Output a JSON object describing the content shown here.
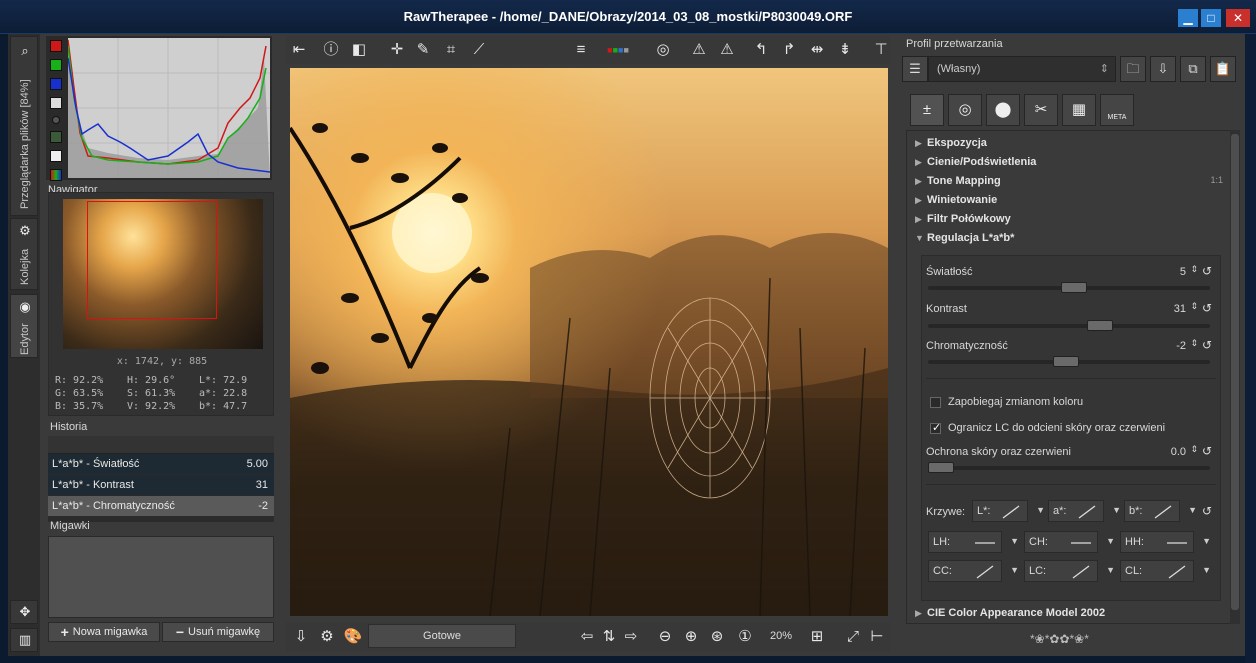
{
  "window": {
    "title": "RawTherapee  - /home/_DANE/Obrazy/2014_03_08_mostki/P8030049.ORF"
  },
  "left_tabs": {
    "file_browser": "Przeglądarka plików [84%]",
    "queue": "Kolejka",
    "editor": "Edytor"
  },
  "navigator": {
    "title": "Nawigator",
    "coords": "x: 1742, y: 885",
    "rgb": {
      "r": "R: 92.2%",
      "g": "G: 63.5%",
      "b": "B: 35.7%"
    },
    "hsv": {
      "h": "H: 29.6°",
      "s": "S: 61.3%",
      "v": "V: 92.2%"
    },
    "lab": {
      "l": "L*:  72.9",
      "a": "a*:  22.8",
      "b": "b*:  47.7"
    }
  },
  "history": {
    "title": "Historia",
    "rows": [
      {
        "name": "L*a*b* - Światłość",
        "value": "5.00"
      },
      {
        "name": "L*a*b* - Kontrast",
        "value": "31"
      },
      {
        "name": "L*a*b* - Chromatyczność",
        "value": "-2"
      }
    ]
  },
  "snapshots": {
    "title": "Migawki",
    "add_label": "Nowa migawka",
    "remove_label": "Usuń migawkę"
  },
  "statusbar": {
    "status": "Gotowe",
    "zoom": "20%"
  },
  "profile": {
    "label": "Profil przetwarzania",
    "value": "(Własny)"
  },
  "tools": {
    "exposure": "Ekspozycja",
    "shadows": "Cienie/Podświetlenia",
    "tonemap": "Tone Mapping",
    "tonemap_badge": "1:1",
    "vignette": "Winietowanie",
    "graduated": "Filtr Połówkowy",
    "lab": "Regulacja L*a*b*",
    "ciecam": "CIE Color Appearance Model 2002"
  },
  "lab": {
    "lightness": {
      "label": "Światłość",
      "value": "5",
      "fraction": 0.52
    },
    "contrast": {
      "label": "Kontrast",
      "value": "31",
      "fraction": 0.62
    },
    "chroma": {
      "label": "Chromatyczność",
      "value": "-2",
      "fraction": 0.49
    },
    "avoid_shift": {
      "label": "Zapobiegaj zmianom koloru",
      "checked": false
    },
    "restrict_lc": {
      "label": "Ogranicz LC do odcieni skóry oraz czerwieni",
      "checked": true
    },
    "skin_protect": {
      "label": "Ochrona skóry oraz czerwieni",
      "value": "0.0",
      "fraction": 0.0
    },
    "curves_label": "Krzywe:",
    "curves": {
      "l": "L*:",
      "a": "a*:",
      "b": "b*:",
      "lh": "LH:",
      "ch": "CH:",
      "hh": "HH:",
      "cc": "CC:",
      "lc": "LC:",
      "cl": "CL:"
    }
  },
  "meta_tab": "META",
  "ornament": "*❀*✿✿*❀*"
}
